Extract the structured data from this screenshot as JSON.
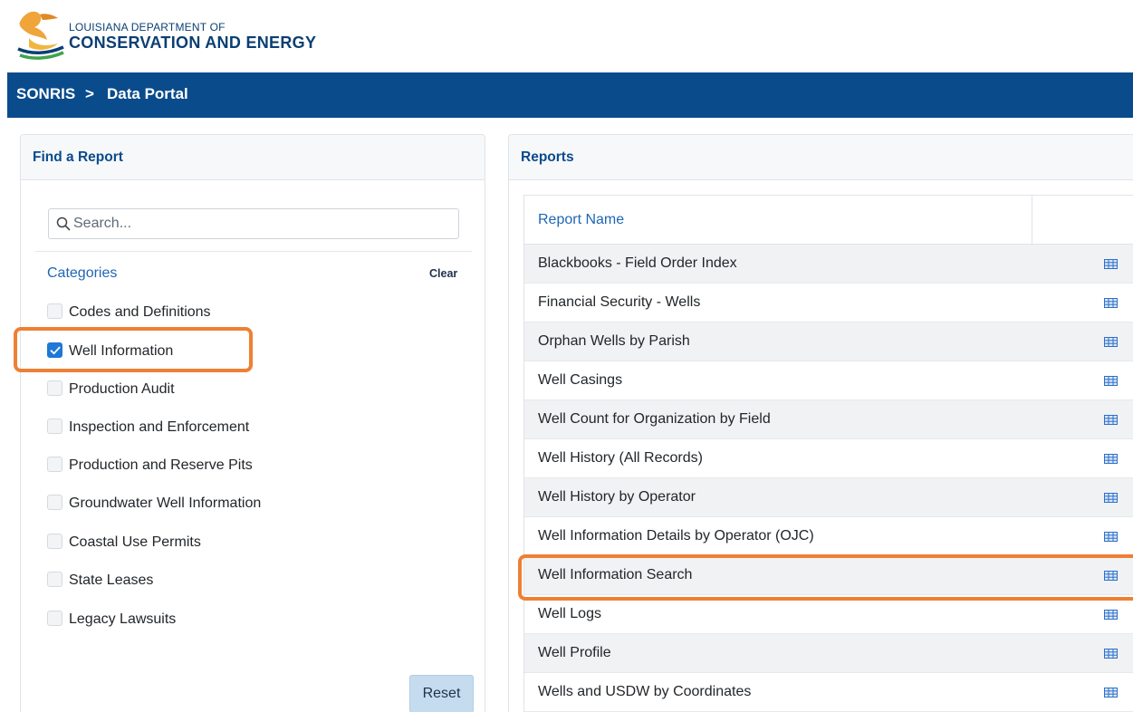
{
  "header": {
    "logo_line1": "LOUISIANA DEPARTMENT OF",
    "logo_line2": "CONSERVATION AND ENERGY"
  },
  "breadcrumb": {
    "home": "SONRIS",
    "separator": ">",
    "current": "Data Portal"
  },
  "find_report": {
    "title": "Find a Report",
    "search_placeholder": "Search...",
    "search_value": "",
    "categories_label": "Categories",
    "clear_label": "Clear",
    "categories": [
      {
        "label": "Codes and Definitions",
        "checked": false
      },
      {
        "label": "Well Information",
        "checked": true
      },
      {
        "label": "Production Audit",
        "checked": false
      },
      {
        "label": "Inspection and Enforcement",
        "checked": false
      },
      {
        "label": "Production and Reserve Pits",
        "checked": false
      },
      {
        "label": "Groundwater Well Information",
        "checked": false
      },
      {
        "label": "Coastal Use Permits",
        "checked": false
      },
      {
        "label": "State Leases",
        "checked": false
      },
      {
        "label": "Legacy Lawsuits",
        "checked": false
      }
    ],
    "reset_label": "Reset"
  },
  "reports": {
    "title": "Reports",
    "column_header": "Report Name",
    "rows": [
      "Blackbooks - Field Order Index",
      "Financial Security - Wells",
      "Orphan Wells by Parish",
      "Well Casings",
      "Well Count for Organization by Field",
      "Well History (All Records)",
      "Well History by Operator",
      "Well Information Details by Operator (OJC)",
      "Well Information Search",
      "Well Logs",
      "Well Profile",
      "Wells and USDW by Coordinates"
    ],
    "row_icon": "table-grid-icon"
  },
  "colors": {
    "navbar": "#0a4b8c",
    "accent_link": "#1f66b3",
    "highlight": "#ee8034",
    "checkbox_checked": "#1f77d6",
    "reset_button": "#c5dcef"
  }
}
